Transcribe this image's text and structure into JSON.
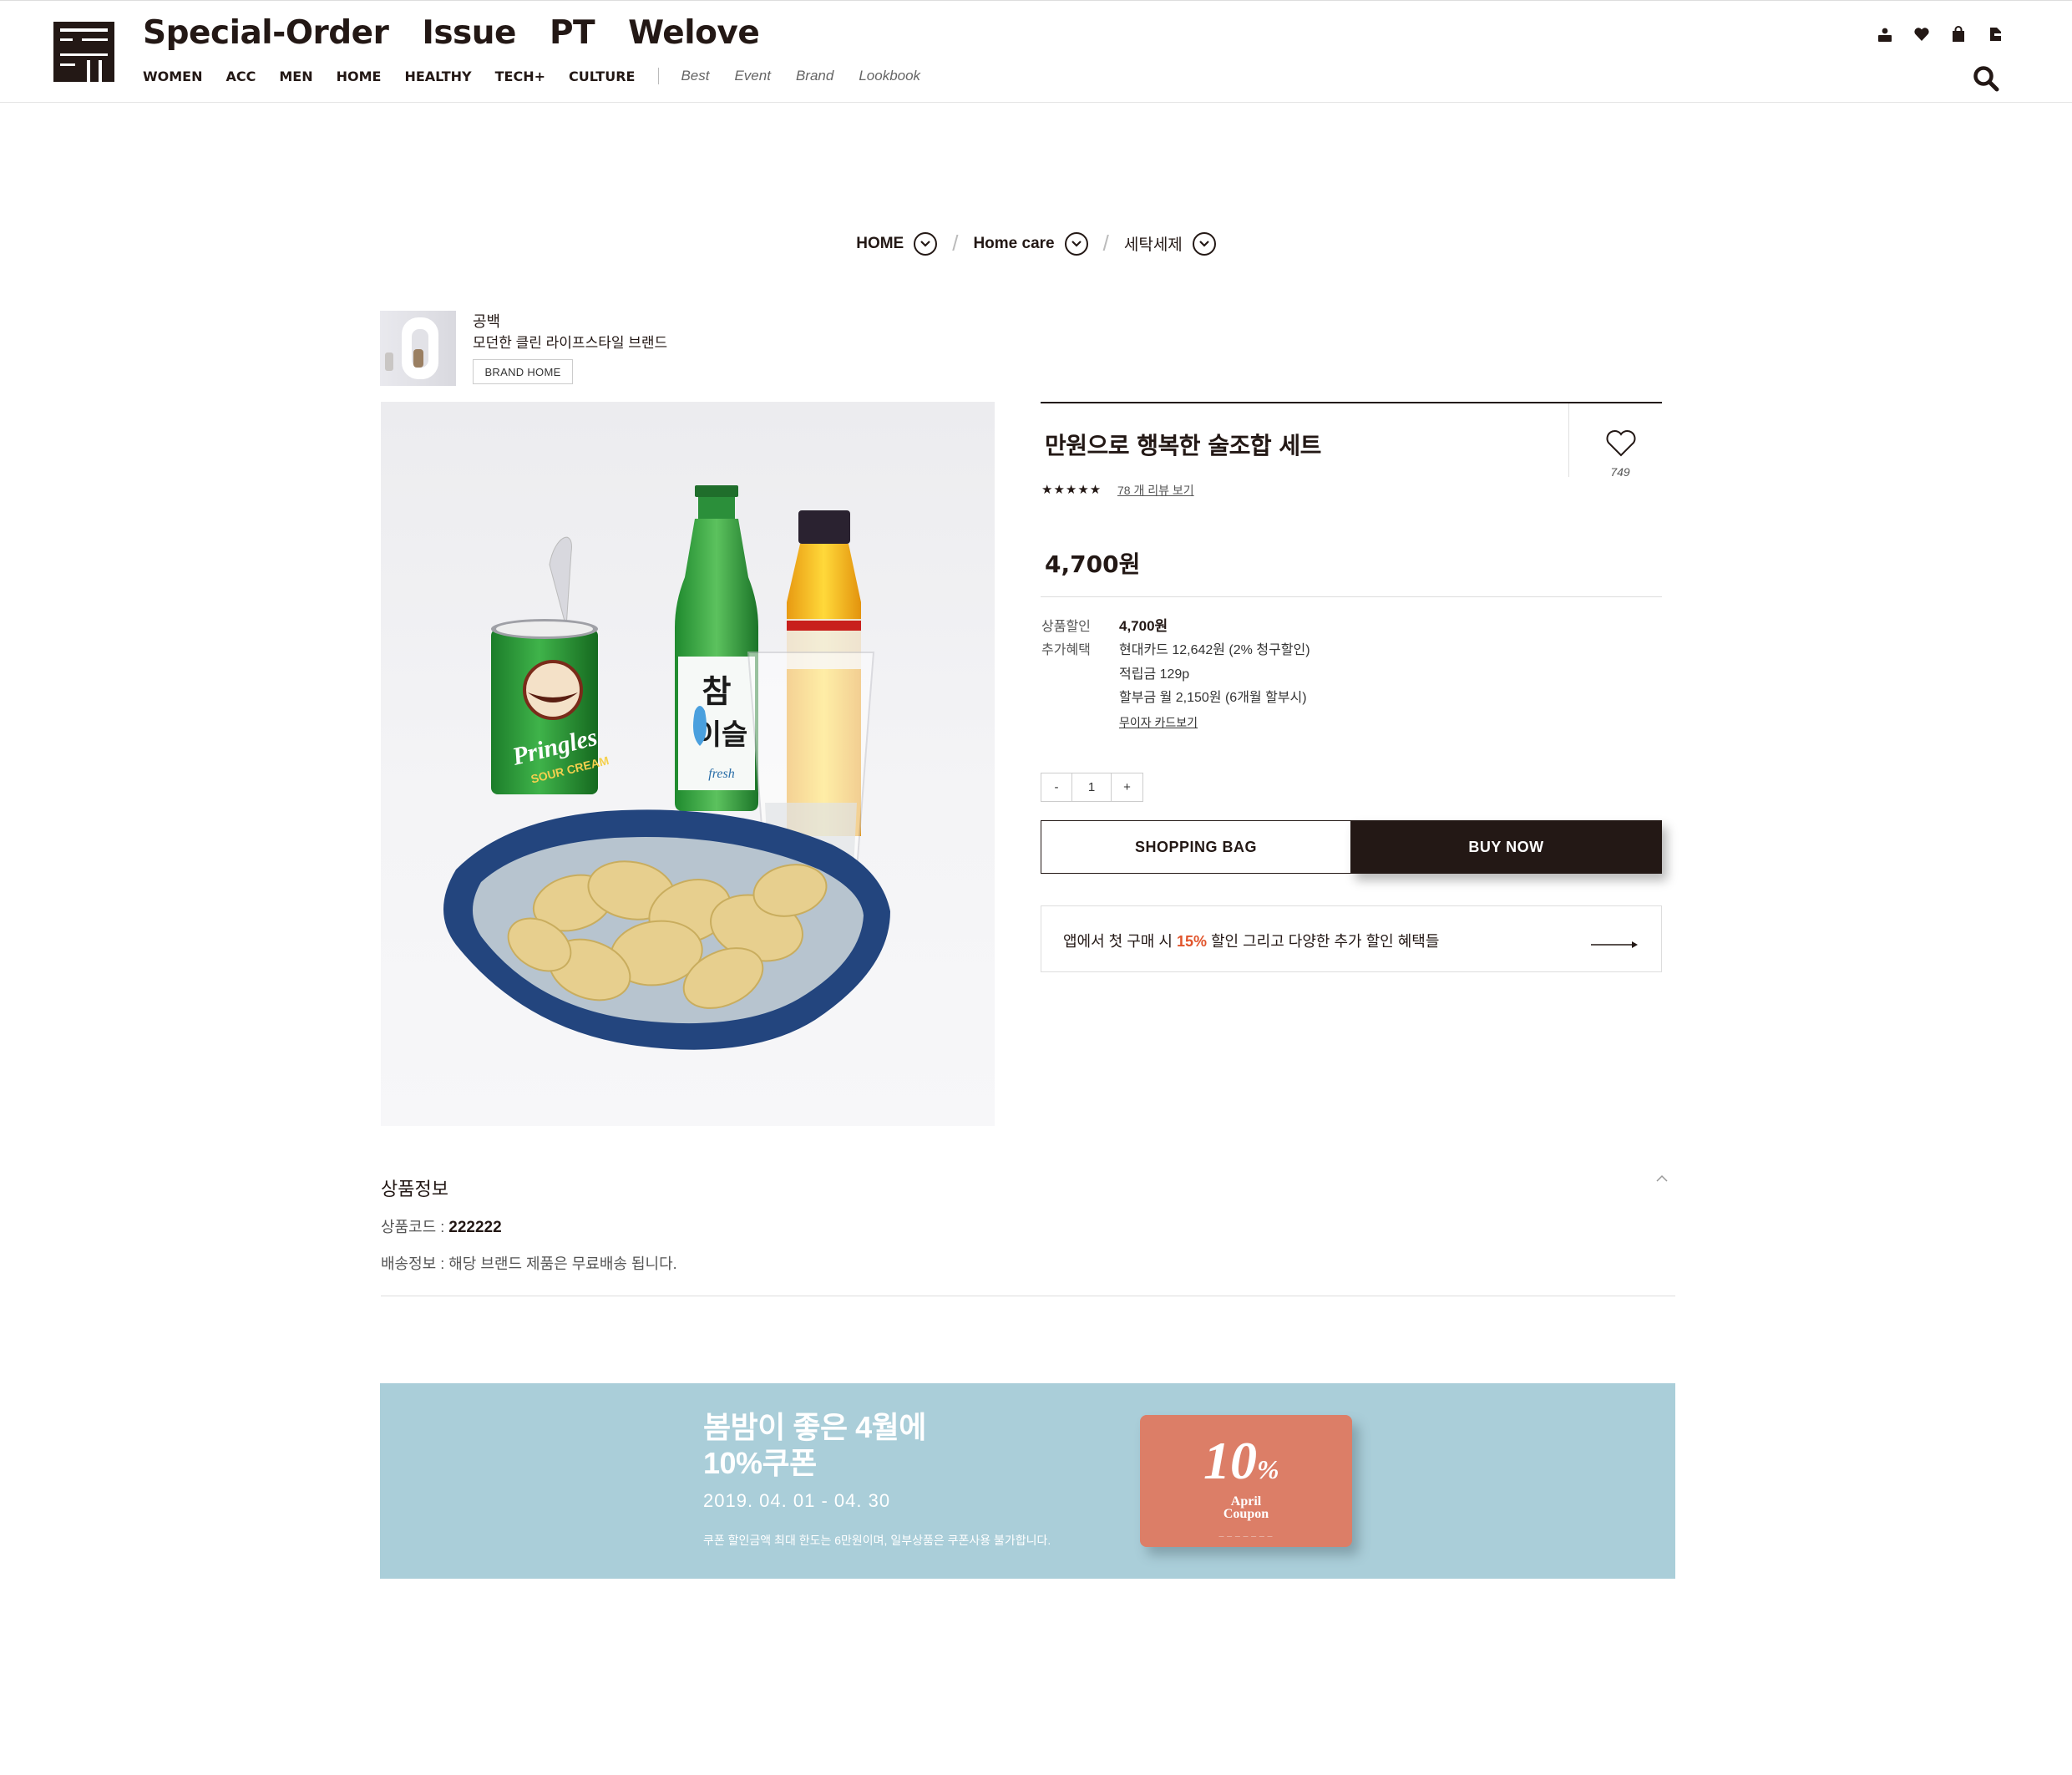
{
  "header": {
    "main_nav": [
      "Special-Order",
      "Issue",
      "PT",
      "Welove"
    ],
    "categories": [
      "WOMEN",
      "ACC",
      "MEN",
      "HOME",
      "HEALTHY",
      "TECH+",
      "CULTURE"
    ],
    "extras": [
      "Best",
      "Event",
      "Brand",
      "Lookbook"
    ],
    "util_icons": [
      "user-icon",
      "heart-icon",
      "bag-icon",
      "menu-book-icon"
    ],
    "search_icon": "search-icon"
  },
  "breadcrumb": [
    "HOME",
    "Home care",
    "세탁세제"
  ],
  "brand": {
    "name": "공백",
    "description": "모던한 클린 라이프스타일 브랜드",
    "home_button": "BRAND HOME"
  },
  "product": {
    "title": "만원으로 행복한 술조합 세트",
    "stars": "★★★★★",
    "rating": 4.5,
    "reviews_link": "78 개 리뷰 보기",
    "wish_count": "749",
    "price": "4,700원",
    "benefit_labels": {
      "discount": "상품할인",
      "extra": "추가혜택"
    },
    "discount_price": "4,700원",
    "benefits": [
      "현대카드 12,642원 (2% 청구할인)",
      "적립금 129p",
      "할부금 월 2,150원 (6개월 할부시)"
    ],
    "card_link": "무이자 카드보기",
    "quantity": {
      "minus": "-",
      "value": "1",
      "plus": "+"
    },
    "shopping_bag": "SHOPPING BAG",
    "buy_now": "BUY NOW",
    "app_banner": {
      "before": "앱에서 첫 구매 시 ",
      "highlight": "15%",
      "after": " 할인 그리고 다양한 추가 할인 혜택들"
    }
  },
  "product_info": {
    "title": "상품정보",
    "code_label": "상품코드 : ",
    "code_value": "222222",
    "shipping": "배송정보 : 해당 브랜드 제품은 무료배송 됩니다."
  },
  "coupon_banner": {
    "line1": "봄밤이 좋은 4월에",
    "line2": "10%쿠폰",
    "date": "2019. 04. 01 - 04. 30",
    "note": "쿠폰 할인금액 최대 한도는 6만원이며, 일부상품은 쿠폰사용 불가합니다.",
    "card_number": "10",
    "card_percent": "%",
    "card_line1": "April",
    "card_line2": "Coupon"
  },
  "colors": {
    "brand_dark": "#231815",
    "accent_orange": "#e1542b",
    "banner_blue": "#aaced9",
    "coupon_card": "#dc7e67"
  }
}
